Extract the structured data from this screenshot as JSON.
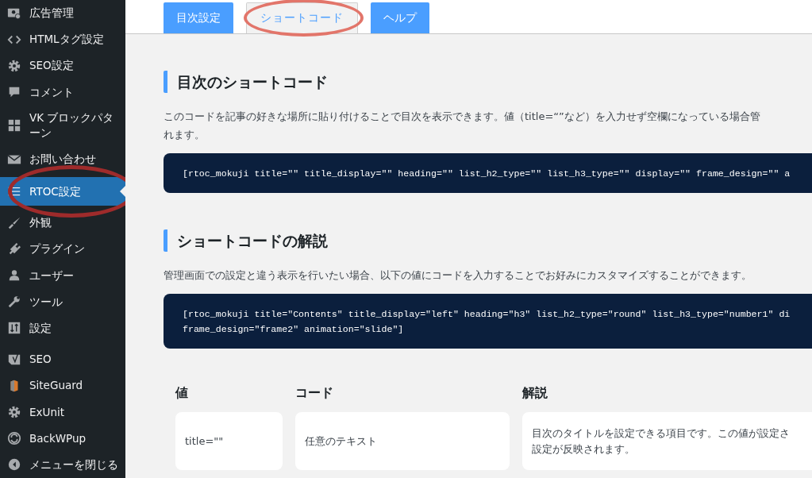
{
  "sidebar": {
    "sections": [
      {
        "items": [
          {
            "label": "広告管理",
            "selected": false,
            "circled": false
          },
          {
            "label": "HTMLタグ設定",
            "selected": false,
            "circled": false
          },
          {
            "label": "SEO設定",
            "selected": false,
            "circled": false
          },
          {
            "label": "コメント",
            "selected": false,
            "circled": false
          },
          {
            "label": "VK ブロックパターン",
            "selected": false,
            "circled": false
          },
          {
            "label": "お問い合わせ",
            "selected": false,
            "circled": false
          },
          {
            "label": "RTOC設定",
            "selected": true,
            "circled": true
          },
          {
            "label": "外観",
            "selected": false,
            "circled": false
          },
          {
            "label": "プラグイン",
            "selected": false,
            "circled": false
          },
          {
            "label": "ユーザー",
            "selected": false,
            "circled": false
          },
          {
            "label": "ツール",
            "selected": false,
            "circled": false
          },
          {
            "label": "設定",
            "selected": false,
            "circled": false
          }
        ]
      },
      {
        "items": [
          {
            "label": "SEO",
            "selected": false,
            "circled": false
          },
          {
            "label": "SiteGuard",
            "selected": false,
            "circled": false
          },
          {
            "label": "ExUnit",
            "selected": false,
            "circled": false
          },
          {
            "label": "BackWPup",
            "selected": false,
            "circled": false
          },
          {
            "label": "メニューを閉じる",
            "selected": false,
            "circled": false
          }
        ]
      }
    ]
  },
  "tabs": [
    {
      "label": "目次設定",
      "selected": false,
      "circled": false
    },
    {
      "label": "ショートコード",
      "selected": true,
      "circled": true
    },
    {
      "label": "ヘルプ",
      "selected": false,
      "circled": false
    }
  ],
  "sections": [
    {
      "heading": "目次のショートコード",
      "description": [
        "このコードを記事の好きな場所に貼り付けることで目次を表示できます。値（title=“”など）を入力せず空欄になっている場合管",
        "れます。"
      ],
      "code": [
        "[rtoc_mokuji title=\"\" title_display=\"\" heading=\"\" list_h2_type=\"\" list_h3_type=\"\" display=\"\" frame_design=\"\" a"
      ]
    },
    {
      "heading": "ショートコードの解説",
      "description": [
        "管理画面での設定と違う表示を行いたい場合、以下の値にコードを入力することでお好みにカスタマイズすることができます。"
      ],
      "code": [
        "[rtoc_mokuji title=\"Contents\" title_display=\"left\" heading=\"h3\" list_h2_type=\"round\" list_h3_type=\"number1\" di",
        "frame_design=\"frame2\" animation=\"slide\"]"
      ]
    }
  ],
  "table": {
    "columns": [
      "値",
      "コード",
      "解説"
    ],
    "rows": [
      {
        "value": "title=\"\"",
        "code": "任意のテキスト",
        "description": [
          "目次のタイトルを設定できる項目です。この値が設定さ",
          "設定が反映されます。"
        ]
      }
    ]
  }
}
